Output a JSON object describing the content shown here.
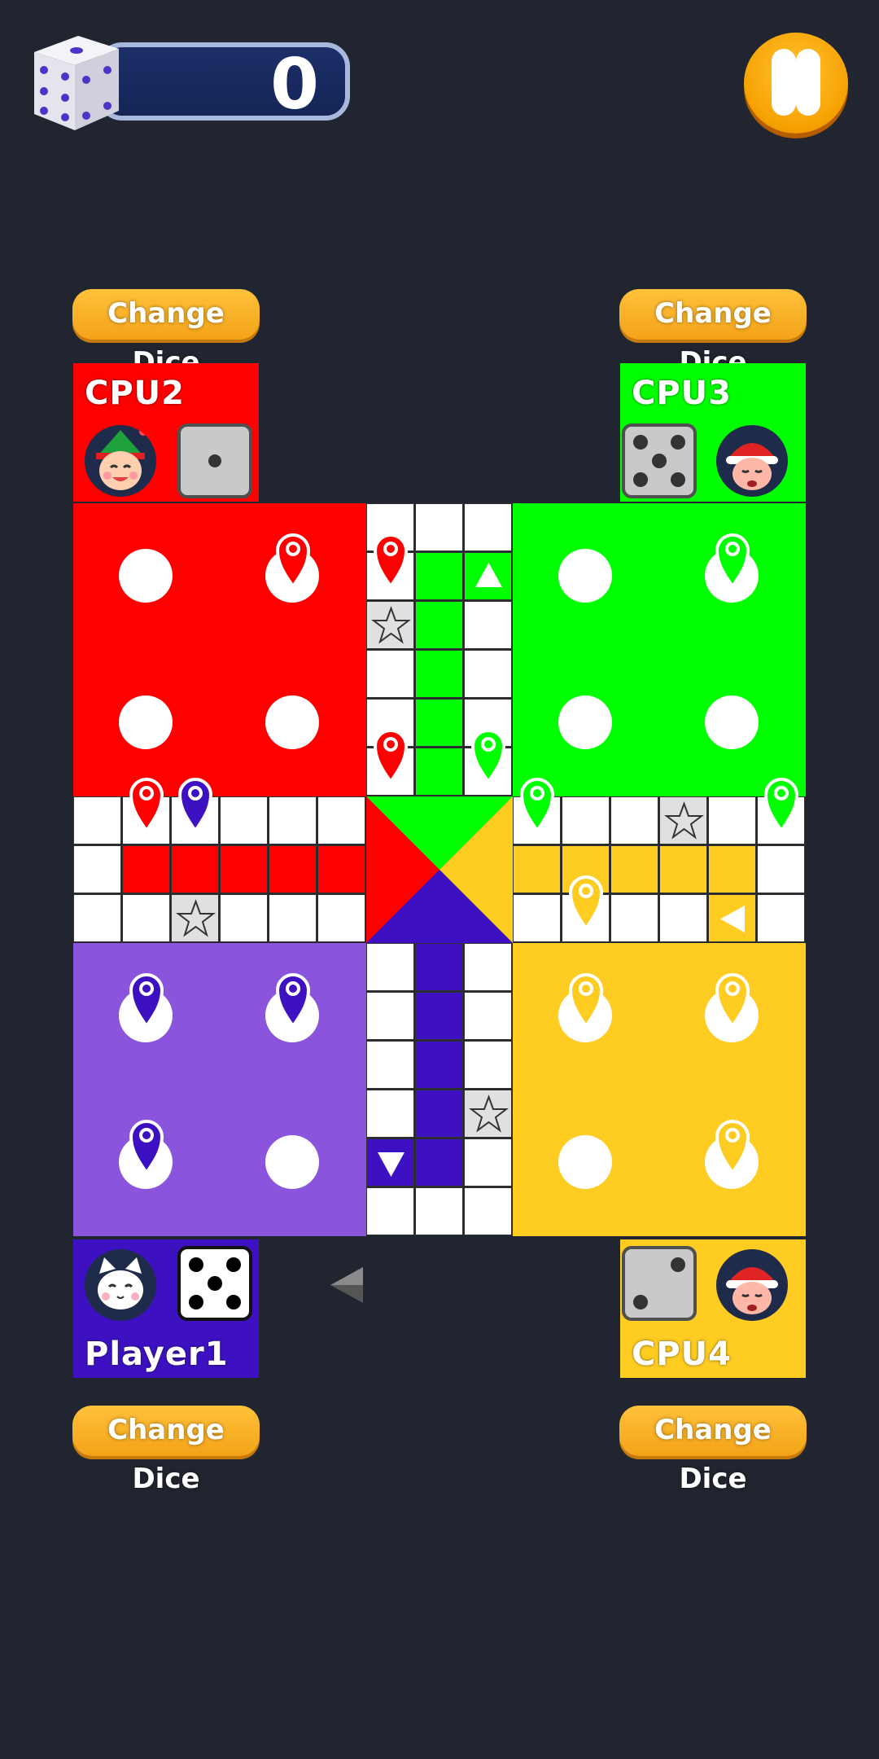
{
  "header": {
    "score": "0",
    "score_dice_icon": "dice-icon",
    "pause_icon": "pause-icon"
  },
  "change_dice_label": "Change Dice",
  "players": {
    "cpu2": {
      "name": "CPU2",
      "color": "#ff0000",
      "dice_value": 1,
      "avatar": "elf-avatar"
    },
    "cpu3": {
      "name": "CPU3",
      "color": "#00ff00",
      "dice_value": 5,
      "avatar": "santa-avatar"
    },
    "player1": {
      "name": "Player1",
      "color": "#3d11c1",
      "dice_value": 5,
      "avatar": "cat-avatar"
    },
    "cpu4": {
      "name": "CPU4",
      "color": "#ffcc22",
      "dice_value": 2,
      "avatar": "santa-avatar"
    }
  },
  "colors": {
    "red": "#ff0000",
    "green": "#00ff00",
    "purple": "#8a55dc",
    "purple_dark": "#3d11c1",
    "yellow": "#ffcc22",
    "background": "#21252f",
    "button": "#f5a623"
  },
  "icons": {
    "star": "star-icon",
    "arrow": "arrow-icon",
    "token": "pawn-marker-icon",
    "turn_indicator": "triangle-left-icon"
  }
}
